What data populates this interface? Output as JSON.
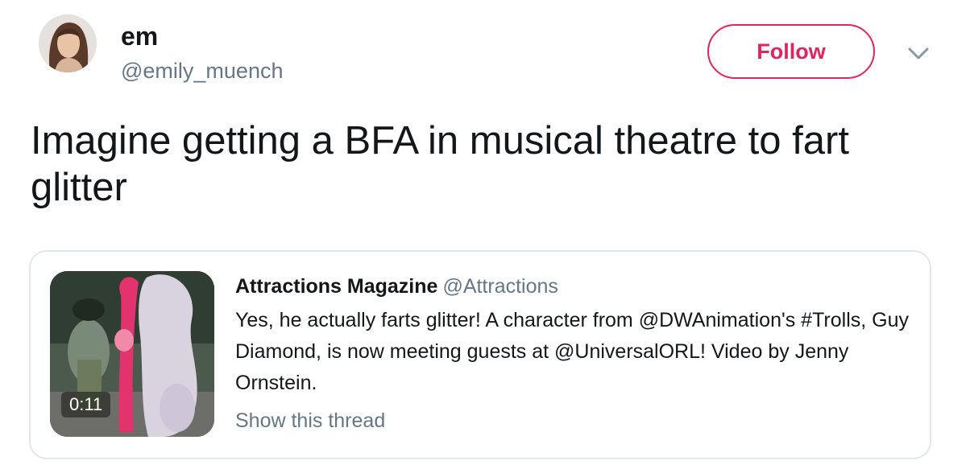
{
  "author": {
    "display_name": "em",
    "handle": "@emily_muench"
  },
  "actions": {
    "follow_label": "Follow",
    "menu_icon": "chevron-down-icon"
  },
  "tweet": {
    "text": "Imagine getting a BFA in musical theatre to fart glitter"
  },
  "quoted_tweet": {
    "author_name": "Attractions Magazine",
    "author_handle": "@Attractions",
    "text": "Yes, he actually farts glitter! A character from @DWAnimation's #Trolls, Guy Diamond, is now meeting guests at @UniversalORL! Video by Jenny Ornstein.",
    "video_duration": "0:11",
    "show_thread_label": "Show this thread"
  },
  "colors": {
    "follow_accent": "#e0245e",
    "secondary_text": "#657786",
    "border": "#e1e8ed"
  }
}
